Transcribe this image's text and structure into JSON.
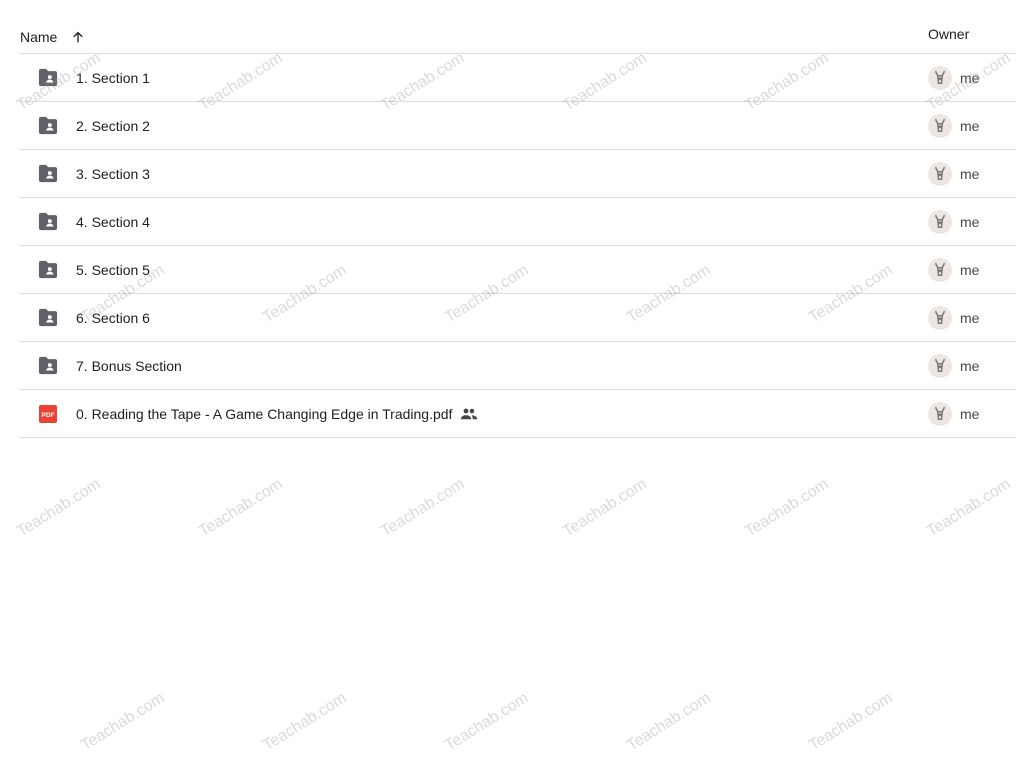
{
  "header": {
    "name_label": "Name",
    "owner_label": "Owner",
    "sort_icon": "arrow-up-icon"
  },
  "rows": [
    {
      "name": "1. Section 1",
      "type": "shared-folder",
      "owner": "me"
    },
    {
      "name": "2. Section 2",
      "type": "shared-folder",
      "owner": "me"
    },
    {
      "name": "3. Section 3",
      "type": "shared-folder",
      "owner": "me"
    },
    {
      "name": "4. Section 4",
      "type": "shared-folder",
      "owner": "me"
    },
    {
      "name": "5. Section 5",
      "type": "shared-folder",
      "owner": "me"
    },
    {
      "name": "6. Section 6",
      "type": "shared-folder",
      "owner": "me"
    },
    {
      "name": "7. Bonus Section",
      "type": "shared-folder",
      "owner": "me"
    },
    {
      "name": "0. Reading the Tape - A Game Changing Edge in Trading.pdf",
      "type": "pdf",
      "shared": true,
      "owner": "me",
      "pdf_badge": "PDF"
    }
  ],
  "watermark": "Teachab.com",
  "colors": {
    "folder": "#5f6368",
    "pdf": "#ea4335",
    "divider": "#dadce0"
  }
}
